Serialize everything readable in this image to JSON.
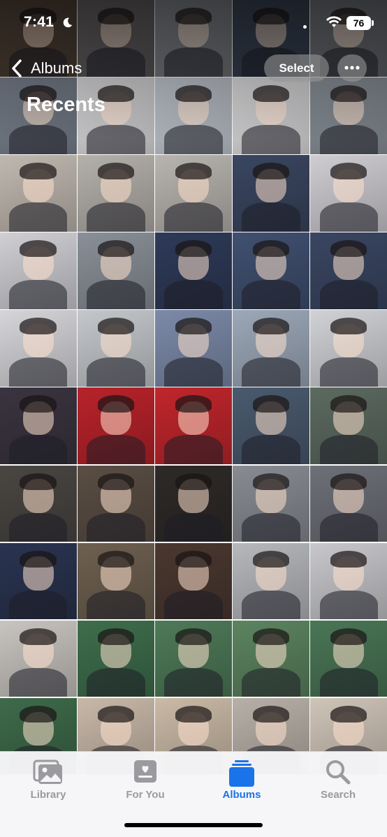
{
  "status_bar": {
    "time": "7:41",
    "battery": "76"
  },
  "nav": {
    "back_label": "Albums",
    "select_label": "Select",
    "title": "Recents"
  },
  "tabs": [
    {
      "label": "Library",
      "icon": "photo-library-icon",
      "active": false
    },
    {
      "label": "For You",
      "icon": "for-you-icon",
      "active": false
    },
    {
      "label": "Albums",
      "icon": "albums-stack-icon",
      "active": true
    },
    {
      "label": "Search",
      "icon": "search-icon",
      "active": false
    }
  ],
  "colors": {
    "accent": "#1a73e8",
    "inactive": "#9a9a9f"
  },
  "photo_grid": {
    "columns": 5,
    "tiles": [
      "#5a4a3e",
      "#6e6a6c",
      "#8a8e94",
      "#3e4a5c",
      "#767a80",
      "#7c8490",
      "#e0e0e2",
      "#c6ccd4",
      "#e2e2e4",
      "#8c949c",
      "#c0b8b0",
      "#b4b0aa",
      "#b8b4ae",
      "#3a4660",
      "#cfcdd2",
      "#cfcfd4",
      "#8a9098",
      "#2e3a58",
      "#405070",
      "#3a4662",
      "#d6d6da",
      "#c4c8cc",
      "#7c8aa8",
      "#9ca8b8",
      "#d0d2d6",
      "#3a3440",
      "#b8232a",
      "#c0262c",
      "#4a5a6e",
      "#5c6a60",
      "#4a4642",
      "#5a4e44",
      "#2e2a28",
      "#888c92",
      "#6e7078",
      "#2a3450",
      "#6e6050",
      "#4a3830",
      "#b6b8bc",
      "#c8c8cc",
      "#c8c4c0",
      "#3e6e4c",
      "#4e7a58",
      "#5c8460",
      "#4a7656",
      "#3e6a4a",
      "#c8b8a8",
      "#cabaa6",
      "#b8b0a8",
      "#cfc4b8"
    ]
  }
}
